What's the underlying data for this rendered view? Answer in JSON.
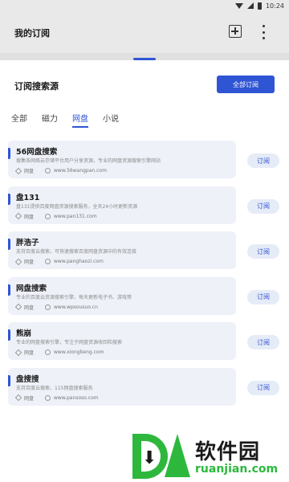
{
  "status_bar": {
    "time": "10:24"
  },
  "appbar": {
    "title": "我的订阅",
    "add_icon": "plus-square-icon",
    "more_icon": "more-vertical-icon"
  },
  "section": {
    "title": "订阅搜索源",
    "all_subscribe_label": "全部订阅"
  },
  "tabs": [
    {
      "label": "全部",
      "active": false
    },
    {
      "label": "磁力",
      "active": false
    },
    {
      "label": "网盘",
      "active": true
    },
    {
      "label": "小说",
      "active": false
    }
  ],
  "sources": [
    {
      "name": "56网盘搜索",
      "desc": "搜集各网络云存储平台用户分享资源，专业的网盘资源搜索引擎网站",
      "tag": "网盘",
      "url": "www.56wangpan.com",
      "button": "订阅"
    },
    {
      "name": "盘131",
      "desc": "盘131提供百度网盘资源搜索服务，全天24小时更新资源",
      "tag": "网盘",
      "url": "www.pan131.com",
      "button": "订阅"
    },
    {
      "name": "胖浩子",
      "desc": "支持百度云搜索，可快速搜索百度网盘资源中的有效连接",
      "tag": "网盘",
      "url": "www.panghaozi.com",
      "button": "订阅"
    },
    {
      "name": "网盘搜索",
      "desc": "专业的百度云资源搜索引擎，每天更新电子书、游戏等",
      "tag": "网盘",
      "url": "www.wpsousuo.cn",
      "button": "订阅"
    },
    {
      "name": "熊崩",
      "desc": "专业的网盘搜索引擎，专注于网盘资源收回和搜索",
      "tag": "网盘",
      "url": "www.xiongbeng.com",
      "button": "订阅"
    },
    {
      "name": "盘搜搜",
      "desc": "支持百度云搜索，115网盘搜索服务",
      "tag": "网盘",
      "url": "www.pansoso.com",
      "button": "订阅"
    }
  ],
  "watermark": {
    "cn": "软件园",
    "en": "ruanjian.com"
  },
  "colors": {
    "accent": "#2f55d4",
    "card_bg": "#eef1f8",
    "watermark_green": "#2db83d"
  }
}
